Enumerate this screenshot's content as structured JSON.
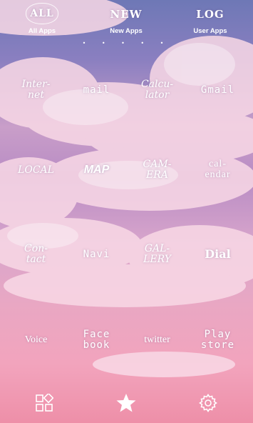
{
  "tabs": [
    {
      "id": "all",
      "badge": "ALL",
      "label": "All Apps"
    },
    {
      "id": "new",
      "badge": "NEW",
      "label": "New Apps"
    },
    {
      "id": "log",
      "badge": "LOG",
      "label": "User Apps"
    }
  ],
  "page_indicator": "• • • • •",
  "apps": [
    [
      "Inter-\nnet",
      "mail",
      "Calcu-\nlator",
      "Gmail"
    ],
    [
      "LOCAL",
      "MAP",
      "CAM-\nERA",
      "cal-\nendar"
    ],
    [
      "Con-\ntact",
      "Navi",
      "GAL-\nLERY",
      "Dial"
    ],
    [
      "Voice",
      "Face\nbook",
      "twitter",
      "Play\nstore"
    ]
  ],
  "dock": [
    {
      "icon": "widgets-icon"
    },
    {
      "icon": "star-icon"
    },
    {
      "icon": "gear-icon"
    }
  ]
}
